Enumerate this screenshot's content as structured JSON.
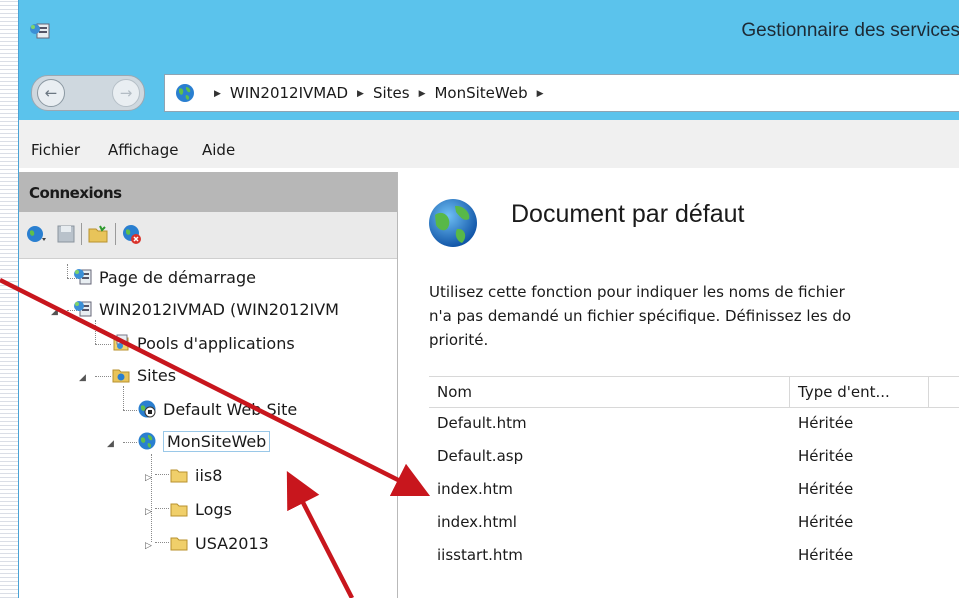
{
  "window": {
    "title": "Gestionnaire des services"
  },
  "address_bar": {
    "crumbs": [
      "WIN2012IVMAD",
      "Sites",
      "MonSiteWeb"
    ]
  },
  "menu": {
    "items": [
      "Fichier",
      "Affichage",
      "Aide"
    ]
  },
  "connections": {
    "title": "Connexions",
    "tree": [
      {
        "label": "Page de démarrage",
        "icon": "start-page-icon"
      },
      {
        "label": "WIN2012IVMAD (WIN2012IVM",
        "icon": "server-icon"
      },
      {
        "label": "Pools d'applications",
        "icon": "app-pools-icon"
      },
      {
        "label": "Sites",
        "icon": "sites-folder-icon"
      },
      {
        "label": "Default Web Site",
        "icon": "stopped-site-globe-icon"
      },
      {
        "label": "MonSiteWeb",
        "icon": "globe-icon"
      },
      {
        "label": "iis8",
        "icon": "folder-icon"
      },
      {
        "label": "Logs",
        "icon": "folder-icon"
      },
      {
        "label": "USA2013",
        "icon": "folder-icon"
      }
    ]
  },
  "feature": {
    "title": "Document par défaut",
    "description_lines": [
      "Utilisez cette fonction pour indiquer les noms de fichier",
      "n'a pas demandé un fichier spécifique. Définissez les do",
      "priorité."
    ],
    "columns": [
      "Nom",
      "Type d'ent..."
    ],
    "rows": [
      {
        "name": "Default.htm",
        "type": "Héritée"
      },
      {
        "name": "Default.asp",
        "type": "Héritée"
      },
      {
        "name": "index.htm",
        "type": "Héritée"
      },
      {
        "name": "index.html",
        "type": "Héritée"
      },
      {
        "name": "iisstart.htm",
        "type": "Héritée"
      }
    ]
  },
  "colors": {
    "titlebar": "#5bc3ec",
    "annotation_arrow": "#c8161d"
  }
}
